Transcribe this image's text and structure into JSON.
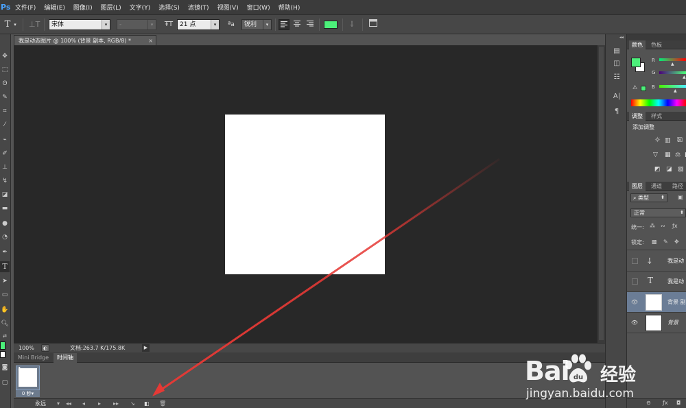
{
  "app": {
    "logo": "Ps"
  },
  "menu": [
    "文件(F)",
    "编辑(E)",
    "图像(I)",
    "图层(L)",
    "文字(Y)",
    "选择(S)",
    "滤镜(T)",
    "视图(V)",
    "窗口(W)",
    "帮助(H)"
  ],
  "options": {
    "tool_icon": "T",
    "font_family": "宋体",
    "font_style": "-",
    "font_size": "21 点",
    "aa_label": "ªa",
    "anti_alias": "锐利",
    "text_color": "#4cf07a"
  },
  "document": {
    "tab_title": "我是动态图片 @ 100% (背景 副本, RGB/8) *",
    "close": "×",
    "zoom": "100%",
    "doc_info": "文档:263.7 K/175.8K"
  },
  "timeline": {
    "tabs": [
      "Mini Bridge",
      "时间轴"
    ],
    "frame_number": "1",
    "frame_delay": "0 秒▾",
    "loop": "永远",
    "loop_arrow": "▾",
    "controls": [
      "◂◂",
      "◂",
      "▸",
      "▸▸"
    ]
  },
  "color_panel": {
    "tabs": [
      "颜色",
      "色板"
    ],
    "labels": [
      "R",
      "G",
      "B"
    ],
    "fg_color": "#4cf07a",
    "bg_color": "#ffffff"
  },
  "adjust_panel": {
    "tabs": [
      "调整",
      "样式"
    ],
    "title": "添加调整"
  },
  "layers_panel": {
    "tabs": [
      "图层",
      "通道",
      "路径"
    ],
    "filter": "类型",
    "blend": "正常",
    "unify_label": "统一:",
    "lock_label": "锁定:",
    "layers": [
      {
        "name": "我是动",
        "type": "warp-text",
        "visible": false
      },
      {
        "name": "我是动",
        "type": "text",
        "visible": false
      },
      {
        "name": "背景 副",
        "type": "pixel",
        "visible": true,
        "selected": true
      },
      {
        "name": "背景",
        "type": "pixel",
        "visible": true,
        "selected": false
      }
    ]
  },
  "watermark": {
    "brand_left": "Bai",
    "brand_right": "经验",
    "url": "jingyan.baidu.com"
  },
  "annotation_color": "#e53935"
}
